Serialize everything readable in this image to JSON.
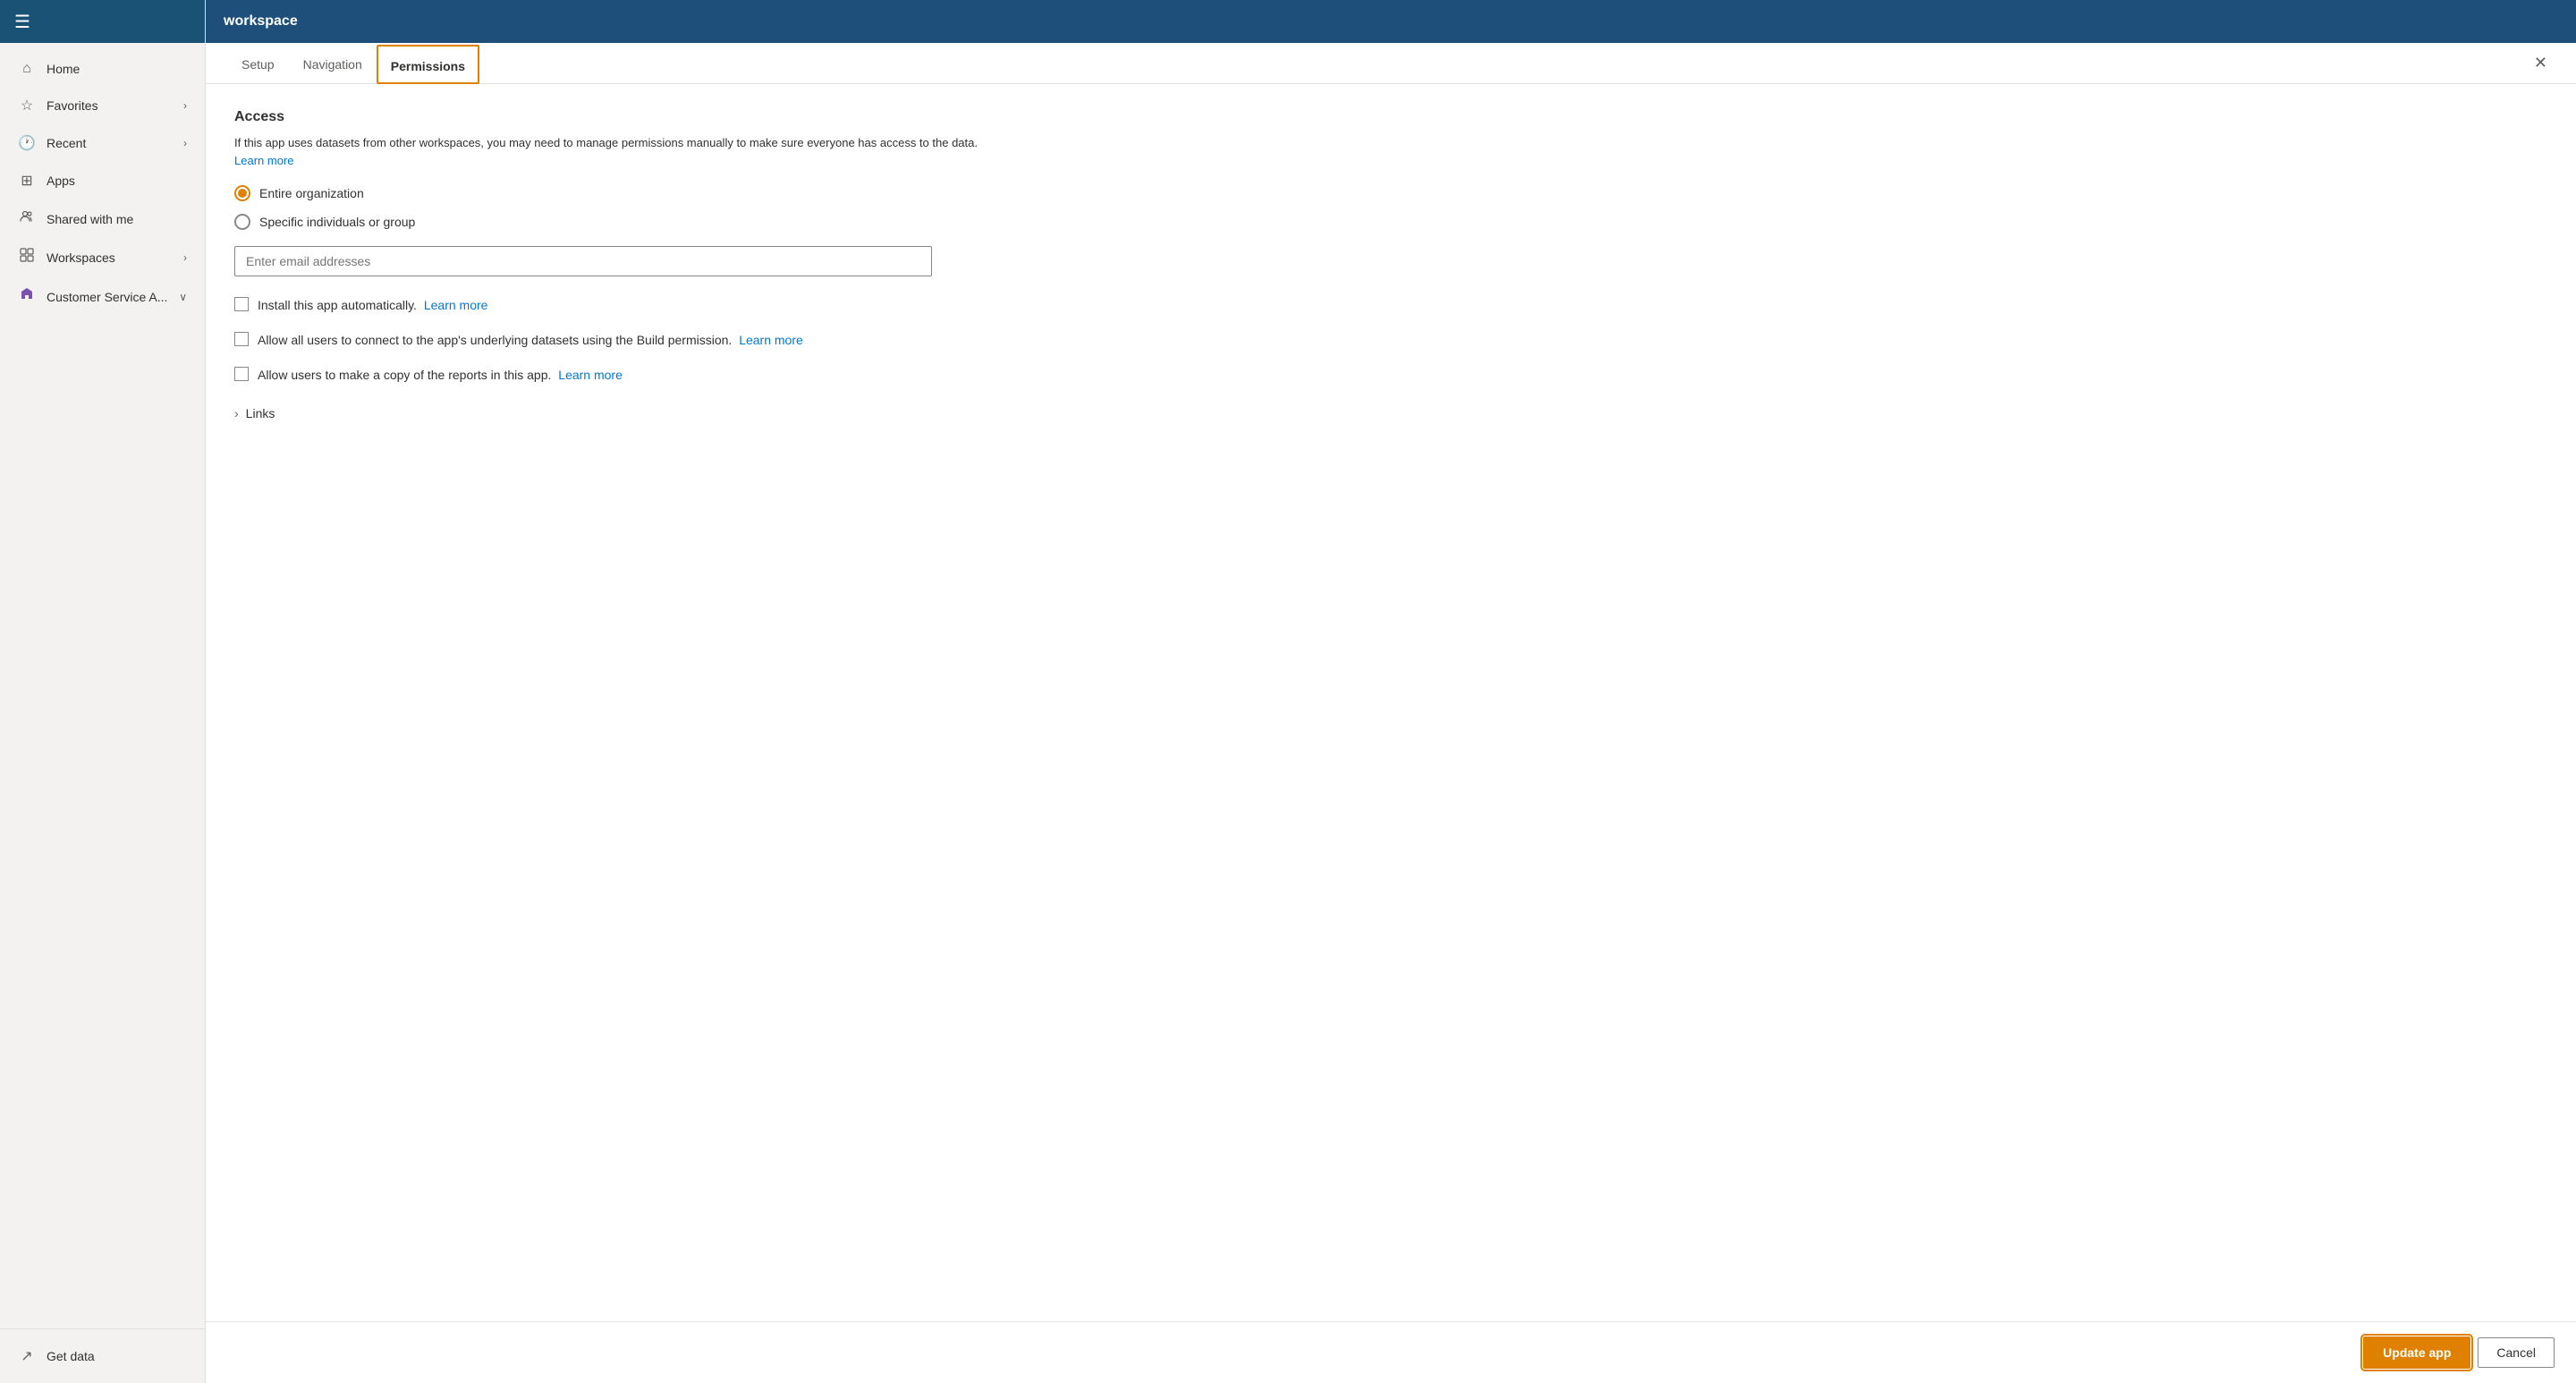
{
  "sidebar": {
    "title": "workspace",
    "hamburger_icon": "☰",
    "items": [
      {
        "id": "home",
        "label": "Home",
        "icon": "⌂"
      },
      {
        "id": "favorites",
        "label": "Favorites",
        "icon": "☆",
        "hasChevron": true
      },
      {
        "id": "recent",
        "label": "Recent",
        "icon": "🕐",
        "hasChevron": true
      },
      {
        "id": "apps",
        "label": "Apps",
        "icon": "⊞"
      },
      {
        "id": "shared",
        "label": "Shared with me",
        "icon": "👤"
      },
      {
        "id": "workspaces",
        "label": "Workspaces",
        "icon": "🗂",
        "hasChevron": true
      },
      {
        "id": "customer-service",
        "label": "Customer Service A...",
        "icon": "💜",
        "hasChevron": true,
        "isPurple": true
      }
    ],
    "footer": {
      "get_data_label": "Get data",
      "get_data_icon": "↗"
    }
  },
  "topbar": {
    "title": "workspace"
  },
  "tabs": {
    "items": [
      {
        "id": "setup",
        "label": "Setup"
      },
      {
        "id": "navigation",
        "label": "Navigation"
      },
      {
        "id": "permissions",
        "label": "Permissions",
        "active": true
      }
    ],
    "close_icon": "✕"
  },
  "permissions": {
    "access_title": "Access",
    "access_description": "If this app uses datasets from other workspaces, you may need to manage permissions manually to make sure everyone has access to the data.",
    "learn_more_1": "Learn more",
    "radio_entire_org": "Entire organization",
    "radio_specific": "Specific individuals or group",
    "email_placeholder": "Enter email addresses",
    "install_auto_label": "Install this app automatically.",
    "install_auto_learn_more": "Learn more",
    "allow_build_label": "Allow all users to connect to the app's underlying datasets using the Build permission.",
    "allow_build_learn_more": "Learn more",
    "allow_copy_label": "Allow users to make a copy of the reports in this app.",
    "allow_copy_learn_more": "Learn more",
    "links_label": "Links"
  },
  "actions": {
    "update_label": "Update app",
    "cancel_label": "Cancel"
  }
}
